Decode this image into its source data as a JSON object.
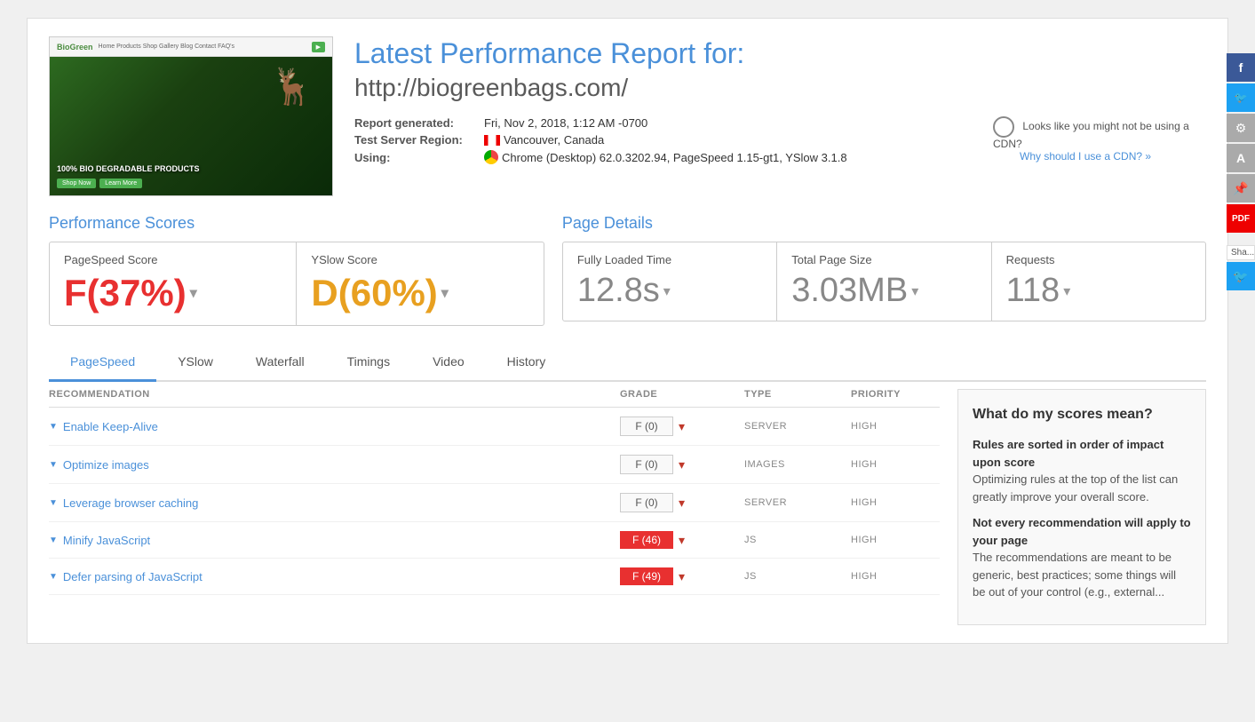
{
  "page": {
    "title": "Latest Performance Report for:",
    "url": "http://biogreenbags.com/",
    "report_generated_label": "Report generated:",
    "report_generated_value": "Fri, Nov 2, 2018, 1:12 AM -0700",
    "test_server_label": "Test Server Region:",
    "test_server_value": "Vancouver, Canada",
    "using_label": "Using:",
    "using_value": "Chrome (Desktop) 62.0.3202.94, PageSpeed 1.15-gt1, YSlow 3.1.8",
    "cdn_notice": "Looks like you might not be using a CDN?",
    "cdn_link": "Why should I use a CDN? »"
  },
  "performance_scores": {
    "section_title": "Performance Scores",
    "pagespeed": {
      "label": "PageSpeed Score",
      "value": "F(37%)",
      "grade": "F"
    },
    "yslow": {
      "label": "YSlow Score",
      "value": "D(60%)",
      "grade": "D"
    }
  },
  "page_details": {
    "section_title": "Page Details",
    "fully_loaded": {
      "label": "Fully Loaded Time",
      "value": "12.8s"
    },
    "total_size": {
      "label": "Total Page Size",
      "value": "3.03MB"
    },
    "requests": {
      "label": "Requests",
      "value": "118"
    }
  },
  "tabs": [
    {
      "id": "pagespeed",
      "label": "PageSpeed",
      "active": true
    },
    {
      "id": "yslow",
      "label": "YSlow",
      "active": false
    },
    {
      "id": "waterfall",
      "label": "Waterfall",
      "active": false
    },
    {
      "id": "timings",
      "label": "Timings",
      "active": false
    },
    {
      "id": "video",
      "label": "Video",
      "active": false
    },
    {
      "id": "history",
      "label": "History",
      "active": false
    }
  ],
  "table_headers": {
    "recommendation": "RECOMMENDATION",
    "grade": "GRADE",
    "type": "TYPE",
    "priority": "PRIORITY"
  },
  "recommendations": [
    {
      "name": "Enable Keep-Alive",
      "grade": "F (0)",
      "grade_type": "normal",
      "type": "SERVER",
      "priority": "HIGH"
    },
    {
      "name": "Optimize images",
      "grade": "F (0)",
      "grade_type": "normal",
      "type": "IMAGES",
      "priority": "HIGH"
    },
    {
      "name": "Leverage browser caching",
      "grade": "F (0)",
      "grade_type": "normal",
      "type": "SERVER",
      "priority": "HIGH"
    },
    {
      "name": "Minify JavaScript",
      "grade": "F (46)",
      "grade_type": "red",
      "type": "JS",
      "priority": "HIGH"
    },
    {
      "name": "Defer parsing of JavaScript",
      "grade": "F (49)",
      "grade_type": "red",
      "type": "JS",
      "priority": "HIGH"
    }
  ],
  "score_meaning": {
    "title": "What do my scores mean?",
    "para1_title": "Rules are sorted in order of impact upon score",
    "para1_text": "Optimizing rules at the top of the list can greatly improve your overall score.",
    "para2_title": "Not every recommendation will apply to your page",
    "para2_text": "The recommendations are meant to be generic, best practices; some things will be out of your control (e.g., external..."
  },
  "side_buttons": [
    {
      "id": "fb",
      "icon": "f",
      "color": "#3b5998"
    },
    {
      "id": "tw",
      "icon": "t",
      "color": "#1da1f2"
    },
    {
      "id": "gear",
      "icon": "⚙",
      "color": "#aaa"
    },
    {
      "id": "a",
      "icon": "A",
      "color": "#aaa"
    },
    {
      "id": "pin",
      "icon": "📌",
      "color": "#aaa"
    },
    {
      "id": "pdf",
      "icon": "PDF",
      "color": "#e00"
    }
  ]
}
